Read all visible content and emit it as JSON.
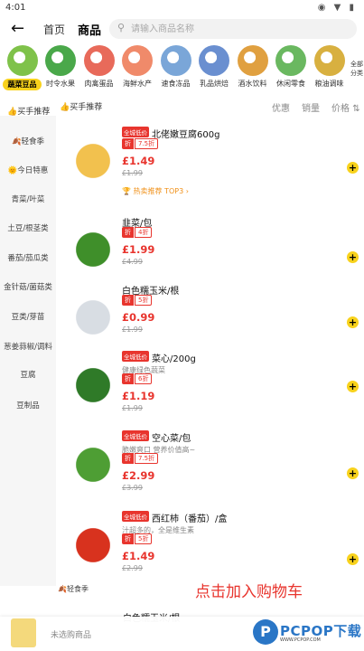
{
  "status": {
    "time": "4:01",
    "icons": "◉ ▼ ▮"
  },
  "header": {
    "back_icon": "←",
    "tabs": [
      "首页",
      "商品"
    ],
    "search_placeholder": "请输入商品名称"
  },
  "categories": [
    {
      "label": "蔬菜豆品",
      "color": "#7fc24a",
      "active": true
    },
    {
      "label": "时令水果",
      "color": "#4aa84a"
    },
    {
      "label": "肉禽蛋品",
      "color": "#e86a5a"
    },
    {
      "label": "海鲜水产",
      "color": "#f08a6a"
    },
    {
      "label": "速食冻品",
      "color": "#7aa6d8"
    },
    {
      "label": "乳品烘焙",
      "color": "#6a8fd0"
    },
    {
      "label": "酒水饮料",
      "color": "#e0a040"
    },
    {
      "label": "休闲零食",
      "color": "#6ab860"
    },
    {
      "label": "粮油调味",
      "color": "#d8b040"
    }
  ],
  "categories_more": "全部分类",
  "sortbar": {
    "section": "买手推荐",
    "options": [
      "优惠",
      "销量",
      "价格"
    ]
  },
  "sidebar": [
    "买手推荐",
    "轻食季",
    "今日特惠",
    "青菜/叶菜",
    "土豆/根茎类",
    "番茄/茄瓜类",
    "金针菇/菌菇类",
    "豆类/芽苗",
    "葱姜蒜椒/调料",
    "豆腐",
    "豆制品"
  ],
  "products": [
    {
      "badge": "全城低价",
      "name": "北佬嫩豆腐600g",
      "discount": "7.5折",
      "price": "£1.49",
      "orig": "£1.99",
      "rank": "热卖推荐 TOP3",
      "img": "#f2c14e"
    },
    {
      "name": "韭菜/包",
      "discount": "4折",
      "price": "£1.99",
      "orig": "£4.99",
      "img": "#3f8f2a"
    },
    {
      "name": "白色糯玉米/根",
      "discount": "5折",
      "price": "£0.99",
      "orig": "£1.99",
      "img": "#d8dde3"
    },
    {
      "badge": "全城低价",
      "name": "菜心/200g",
      "desc": "健康绿色蔬菜",
      "discount": "6折",
      "price": "£1.19",
      "orig": "£1.99",
      "img": "#2f7a28"
    },
    {
      "badge": "全城低价",
      "name": "空心菜/包",
      "desc": "脆嫩爽口 营养价值高~",
      "discount": "7.5折",
      "price": "£2.99",
      "orig": "£3.99",
      "img": "#4e9e34"
    },
    {
      "badge": "全城低价",
      "name": "西红柿（番茄）/盒",
      "desc": "汁超多的，全是维生素",
      "discount": "5折",
      "price": "£1.49",
      "orig": "£2.99",
      "img": "#d8321e"
    }
  ],
  "section2": "轻食季",
  "ad_text": "点击加入购物车",
  "partial_name": "白色糯玉米/根",
  "cartbar": {
    "text": "未选购商品"
  },
  "watermark": {
    "title": "PCPOP下载",
    "sub": "WWW.PCPOP.COM"
  }
}
